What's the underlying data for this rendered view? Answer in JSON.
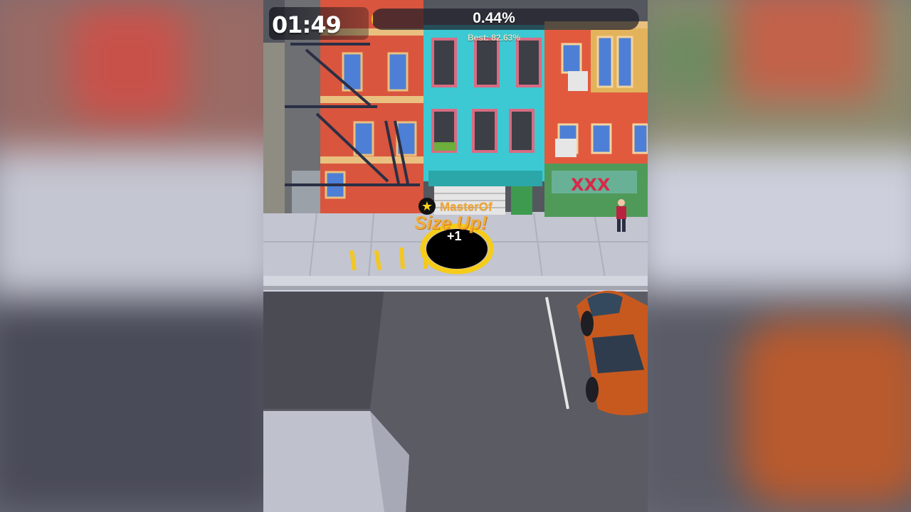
{
  "hud": {
    "timer": "01:49",
    "progress_text": "0.44%",
    "progress_fraction": 0.0044,
    "best_text": "Best: 82.63%"
  },
  "player": {
    "name": "MasterOf",
    "badge_icon": "star-icon",
    "size_up_text": "Size Up!",
    "score_popup": "+1"
  },
  "colors": {
    "hole": "#000000",
    "hole_ring": "#f5cc1a",
    "player_label": "#f1a531",
    "car": "#c7591f"
  }
}
